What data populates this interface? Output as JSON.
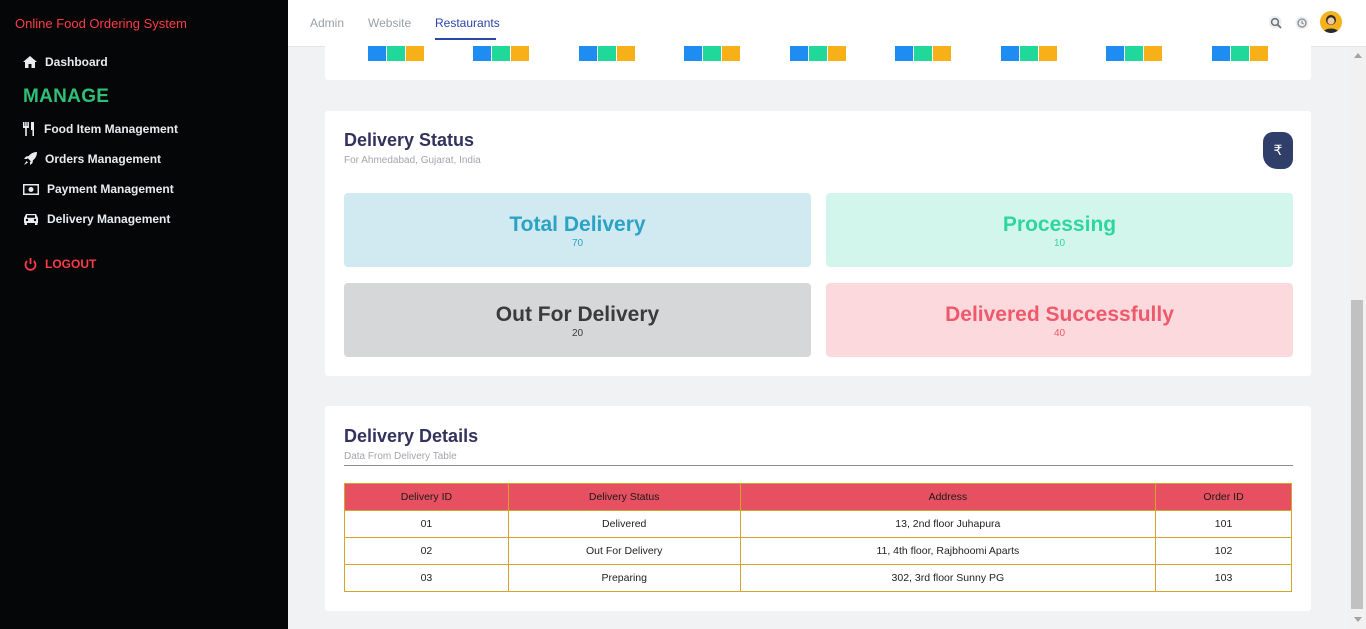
{
  "sidebar": {
    "brand": "Online Food Ordering System",
    "dashboard": "Dashboard",
    "manage_heading": "MANAGE",
    "items": [
      {
        "label": "Food Item Management",
        "icon": "cutlery-icon"
      },
      {
        "label": "Orders Management",
        "icon": "rocket-icon"
      },
      {
        "label": "Payment Management",
        "icon": "money-icon"
      },
      {
        "label": "Delivery Management",
        "icon": "car-icon"
      }
    ],
    "logout": "LOGOUT"
  },
  "topbar": {
    "tabs": [
      "Admin",
      "Website",
      "Restaurants"
    ],
    "active_tab": "Restaurants"
  },
  "legend_colors": [
    "#1e8cf0",
    "#1fd89a",
    "#f8b019"
  ],
  "delivery_status": {
    "title": "Delivery Status",
    "subtitle": "For Ahmedabad, Gujarat, India",
    "currency_symbol": "₹",
    "stats": [
      {
        "label": "Total Delivery",
        "value": "70",
        "bg": "#d1e9f0",
        "color": "#2aa3c4"
      },
      {
        "label": "Processing",
        "value": "10",
        "bg": "#d2f6ec",
        "color": "#2ed69e"
      },
      {
        "label": "Out For Delivery",
        "value": "20",
        "bg": "#d6d7d9",
        "color": "#3a3b3d"
      },
      {
        "label": "Delivered Successfully",
        "value": "40",
        "bg": "#fbd9dd",
        "color": "#ee5a6c"
      }
    ]
  },
  "delivery_details": {
    "title": "Delivery Details",
    "subtitle": "Data From Delivery Table",
    "columns": [
      "Delivery ID",
      "Delivery Status",
      "Address",
      "Order ID"
    ],
    "rows": [
      [
        "01",
        "Delivered",
        "13, 2nd floor Juhapura",
        "101"
      ],
      [
        "02",
        "Out For Delivery",
        "11, 4th floor, Rajbhoomi Aparts",
        "102"
      ],
      [
        "03",
        "Preparing",
        "302, 3rd floor Sunny PG",
        "103"
      ]
    ]
  }
}
